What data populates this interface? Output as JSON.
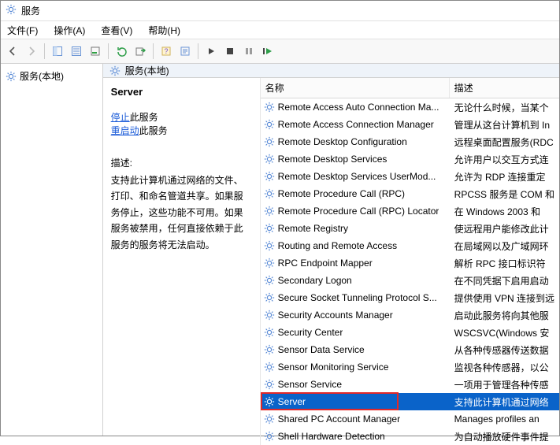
{
  "window": {
    "title": "服务"
  },
  "menus": {
    "file": "文件(F)",
    "action": "操作(A)",
    "view": "查看(V)",
    "help": "帮助(H)"
  },
  "tree": {
    "root_label": "服务(本地)"
  },
  "right_header": {
    "label": "服务(本地)"
  },
  "detail": {
    "service_name": "Server",
    "stop_link_prefix": "停止",
    "stop_link_suffix": "此服务",
    "restart_link_prefix": "重启动",
    "restart_link_suffix": "此服务",
    "desc_label": "描述:",
    "desc_body": "支持此计算机通过网络的文件、打印、和命名管道共享。如果服务停止，这些功能不可用。如果服务被禁用，任何直接依赖于此服务的服务将无法启动。"
  },
  "columns": {
    "name": "名称",
    "desc": "描述"
  },
  "selected_index": 15,
  "rows": [
    {
      "name": "Remote Access Auto Connection Ma...",
      "desc": "无论什么时候，当某个"
    },
    {
      "name": "Remote Access Connection Manager",
      "desc": "管理从这台计算机到 In"
    },
    {
      "name": "Remote Desktop Configuration",
      "desc": "远程桌面配置服务(RDC"
    },
    {
      "name": "Remote Desktop Services",
      "desc": "允许用户以交互方式连"
    },
    {
      "name": "Remote Desktop Services UserMod...",
      "desc": "允许为 RDP 连接重定"
    },
    {
      "name": "Remote Procedure Call (RPC)",
      "desc": "RPCSS 服务是 COM 和"
    },
    {
      "name": "Remote Procedure Call (RPC) Locator",
      "desc": "在 Windows 2003 和"
    },
    {
      "name": "Remote Registry",
      "desc": "使远程用户能修改此计"
    },
    {
      "name": "Routing and Remote Access",
      "desc": "在局域网以及广域网环"
    },
    {
      "name": "RPC Endpoint Mapper",
      "desc": "解析 RPC 接口标识符"
    },
    {
      "name": "Secondary Logon",
      "desc": "在不同凭据下启用启动"
    },
    {
      "name": "Secure Socket Tunneling Protocol S...",
      "desc": "提供使用 VPN 连接到远"
    },
    {
      "name": "Security Accounts Manager",
      "desc": "启动此服务将向其他服"
    },
    {
      "name": "Security Center",
      "desc": "WSCSVC(Windows 安"
    },
    {
      "name": "Sensor Data Service",
      "desc": "从各种传感器传送数据"
    },
    {
      "name": "Sensor Monitoring Service",
      "desc": "监视各种传感器，以公"
    },
    {
      "name": "Sensor Service",
      "desc": "一项用于管理各种传感"
    },
    {
      "name": "Server",
      "desc": "支持此计算机通过网络"
    },
    {
      "name": "Shared PC Account Manager",
      "desc": "Manages profiles an"
    },
    {
      "name": "Shell Hardware Detection",
      "desc": "为自动播放硬件事件提"
    }
  ]
}
